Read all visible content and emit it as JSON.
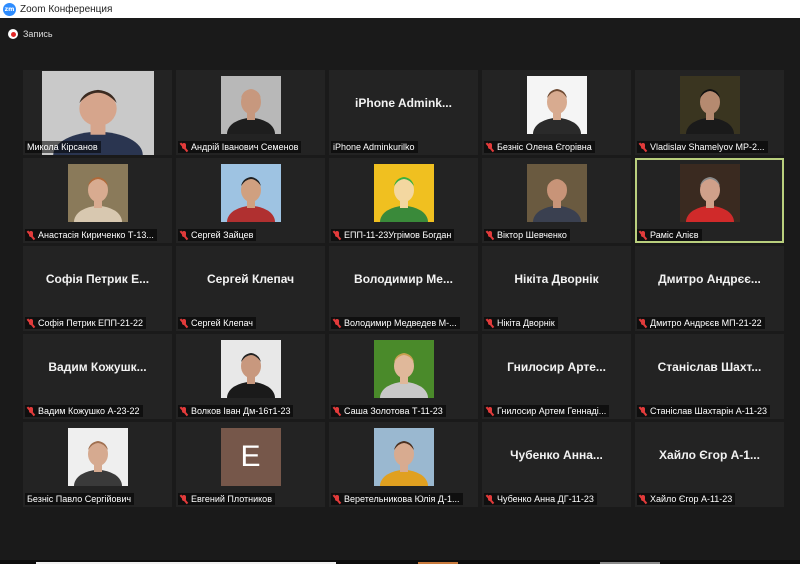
{
  "window": {
    "title": "Zoom Конференция",
    "logo_text": "zm"
  },
  "recording": {
    "label": "Запись"
  },
  "participants": [
    {
      "display_name": "",
      "label": "Микола Кірсанов",
      "muted": false,
      "video": "photo",
      "icon": "man-smiling-photo",
      "active": false
    },
    {
      "display_name": "",
      "label": "Андрій Іванович Семенов",
      "muted": true,
      "video": "photo",
      "icon": "bald-man-photo",
      "active": false
    },
    {
      "display_name": "iPhone  Admink...",
      "label": "iPhone Adminkurilko",
      "muted": false,
      "video": "off",
      "active": false
    },
    {
      "display_name": "",
      "label": "Безніс Олена Єгорівна",
      "muted": true,
      "video": "photo",
      "icon": "woman-portrait-photo",
      "active": false
    },
    {
      "display_name": "",
      "label": "Vladislav Shamelyov MP-2...",
      "muted": true,
      "video": "photo",
      "icon": "person-dark-photo",
      "active": false
    },
    {
      "display_name": "",
      "label": "Анастасія Кириченко Т-13...",
      "muted": true,
      "video": "photo",
      "icon": "girl-outdoor-photo",
      "active": false
    },
    {
      "display_name": "",
      "label": "Сергей Зайцев",
      "muted": true,
      "video": "photo",
      "icon": "man-sunglasses-photo",
      "active": false
    },
    {
      "display_name": "",
      "label": "ЕПП-11-23Угрімов Богдан",
      "muted": true,
      "video": "photo",
      "icon": "cartoon-avatar-photo",
      "active": false
    },
    {
      "display_name": "",
      "label": "Віктор Шевченко",
      "muted": true,
      "video": "photo",
      "icon": "man-hat-photo",
      "active": false
    },
    {
      "display_name": "",
      "label": "Раміс Алієв",
      "muted": true,
      "video": "photo",
      "icon": "man-red-shirt-photo",
      "active": true
    },
    {
      "display_name": "Софія  Петрик  Е...",
      "label": "Софія Петрик ЕПП-21-22",
      "muted": true,
      "video": "off",
      "active": false
    },
    {
      "display_name": "Сергей Клепач",
      "label": "Сергей Клепач",
      "muted": true,
      "video": "off",
      "active": false
    },
    {
      "display_name": "Володимир  Ме...",
      "label": "Володимир Медведев  М-...",
      "muted": true,
      "video": "off",
      "active": false
    },
    {
      "display_name": "Нікіта Дворнік",
      "label": "Нікіта Дворнік",
      "muted": true,
      "video": "off",
      "active": false
    },
    {
      "display_name": "Дмитро  Андрєє...",
      "label": "Дмитро Андрєєв МП-21-22",
      "muted": true,
      "video": "off",
      "active": false
    },
    {
      "display_name": "Вадим  Кожушк...",
      "label": "Вадим Кожушко А-23-22",
      "muted": true,
      "video": "off",
      "active": false
    },
    {
      "display_name": "",
      "label": "Волков Іван Дм-16т1-23",
      "muted": true,
      "video": "photo",
      "icon": "man-sunglasses-dark-photo",
      "active": false
    },
    {
      "display_name": "",
      "label": "Саша Золотова Т-11-23",
      "muted": true,
      "video": "photo",
      "icon": "girl-park-photo",
      "active": false
    },
    {
      "display_name": "Гнилосир  Арте...",
      "label": "Гнилосир Артем Геннаді...",
      "muted": true,
      "video": "off",
      "active": false
    },
    {
      "display_name": "Станіслав  Шахт...",
      "label": "Станіслав Шахтарін А-11-23",
      "muted": true,
      "video": "off",
      "active": false
    },
    {
      "display_name": "",
      "label": "Безніс Павло Сергійович",
      "muted": false,
      "video": "photo",
      "icon": "young-man-photo",
      "active": false
    },
    {
      "display_name": "",
      "label": "Евгений Плотников",
      "muted": true,
      "video": "letter",
      "letter": "Е",
      "active": false
    },
    {
      "display_name": "",
      "label": "Веретельникова Юлія Д-1...",
      "muted": true,
      "video": "photo",
      "icon": "girl-standing-photo",
      "active": false
    },
    {
      "display_name": "Чубенко  Анна...",
      "label": "Чубенко Анна ДГ-11-23",
      "muted": true,
      "video": "off",
      "active": false
    },
    {
      "display_name": "Хайло  Єгор  А-1...",
      "label": "Хайло Єгор А-11-23",
      "muted": true,
      "video": "off",
      "active": false
    }
  ],
  "colors": {
    "background": "#1a1a1a",
    "tile": "#232323",
    "active_border": "#b9cf7d",
    "mute_red": "#e23b3b",
    "logo_blue": "#2d8cff"
  }
}
